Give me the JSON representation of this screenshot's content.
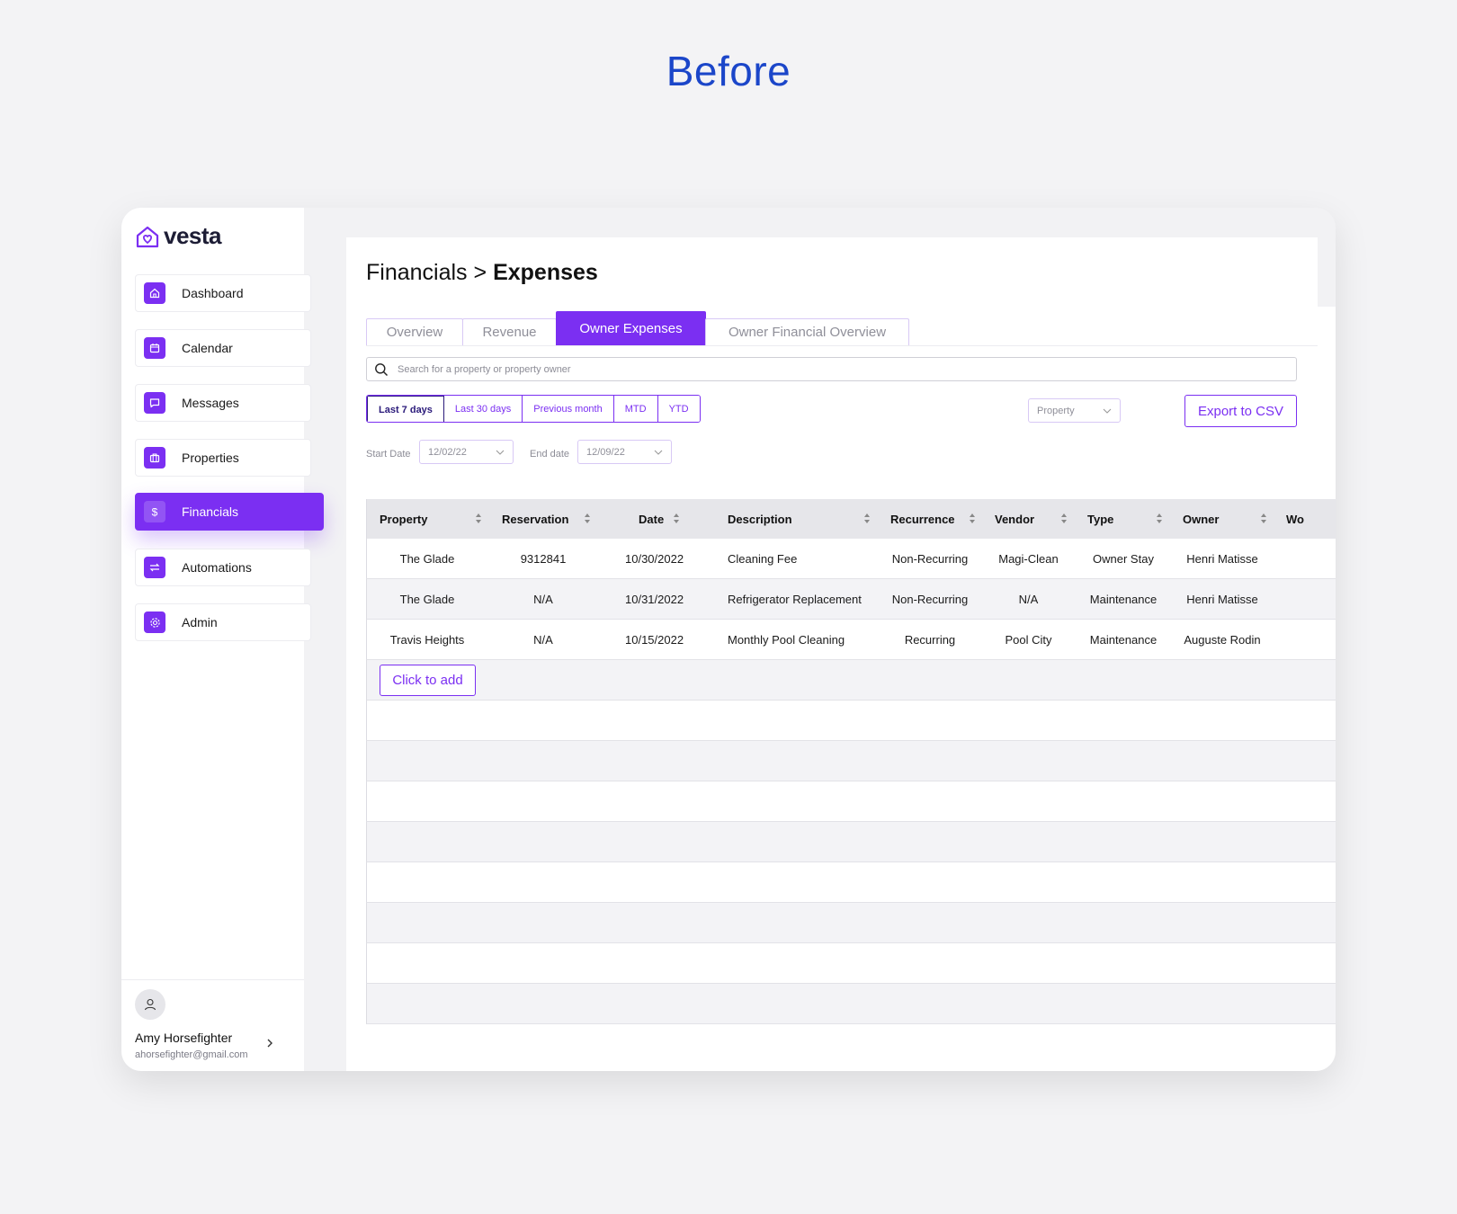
{
  "heading": "Before",
  "brand": {
    "name": "vesta",
    "logo_icon": "house-heart-icon",
    "accent": "#7b2ff2"
  },
  "sidebar": {
    "items": [
      {
        "label": "Dashboard",
        "icon": "home-icon"
      },
      {
        "label": "Calendar",
        "icon": "calendar-icon"
      },
      {
        "label": "Messages",
        "icon": "message-icon"
      },
      {
        "label": "Properties",
        "icon": "briefcase-icon"
      },
      {
        "label": "Financials",
        "icon": "dollar-icon",
        "active": true
      },
      {
        "label": "Automations",
        "icon": "repeat-icon"
      },
      {
        "label": "Admin",
        "icon": "gear-icon"
      }
    ],
    "user": {
      "name": "Amy Horsefighter",
      "email": "ahorsefighter@gmail.com"
    }
  },
  "header": {
    "crumb_parent": "Financials",
    "separator": ">",
    "crumb_current": "Expenses"
  },
  "tabs": [
    {
      "label": "Overview"
    },
    {
      "label": "Revenue"
    },
    {
      "label": "Owner Expenses",
      "active": true
    },
    {
      "label": "Owner Financial Overview"
    }
  ],
  "search": {
    "placeholder": "Search for a property or property owner"
  },
  "ranges": [
    {
      "label": "Last 7 days",
      "active": true
    },
    {
      "label": "Last 30 days"
    },
    {
      "label": "Previous month"
    },
    {
      "label": "MTD"
    },
    {
      "label": "YTD"
    }
  ],
  "filters": {
    "property_placeholder": "Property",
    "start_label": "Start Date",
    "start_value": "12/02/22",
    "end_label": "End date",
    "end_value": "12/09/22"
  },
  "export_label": "Export to CSV",
  "table": {
    "columns": [
      "Property",
      "Reservation",
      "Date",
      "Description",
      "Recurrence",
      "Vendor",
      "Type",
      "Owner",
      "Wo"
    ],
    "rows": [
      [
        "The Glade",
        "9312841",
        "10/30/2022",
        "Cleaning Fee",
        "Non-Recurring",
        "Magi-Clean",
        "Owner Stay",
        "Henri Matisse"
      ],
      [
        "The Glade",
        "N/A",
        "10/31/2022",
        "Refrigerator Replacement",
        "Non-Recurring",
        "N/A",
        "Maintenance",
        "Henri Matisse"
      ],
      [
        "Travis Heights",
        "N/A",
        "10/15/2022",
        "Monthly Pool Cleaning",
        "Recurring",
        "Pool City",
        "Maintenance",
        "Auguste Rodin"
      ]
    ],
    "add_label": "Click to add"
  }
}
